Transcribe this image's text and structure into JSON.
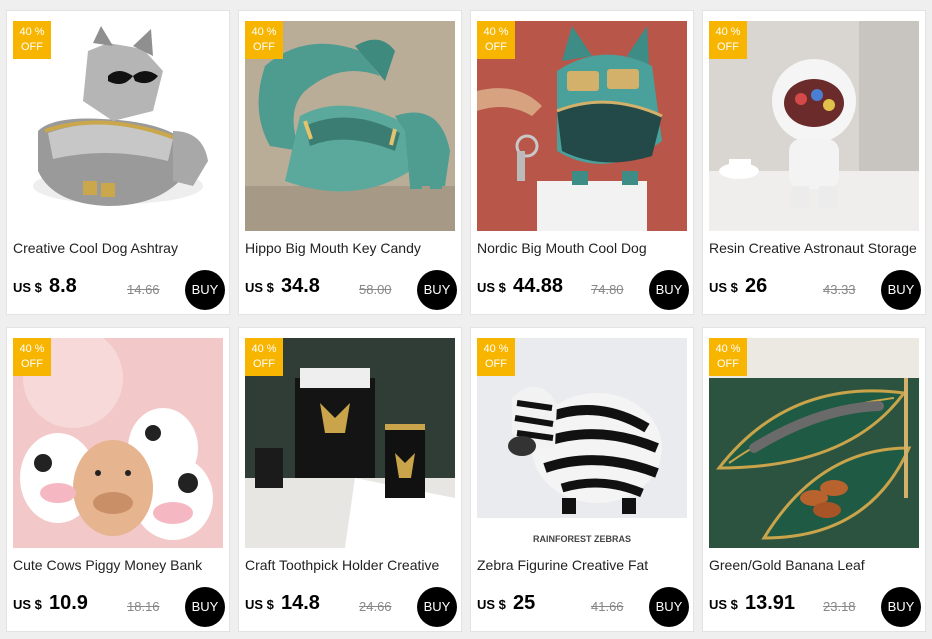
{
  "colors": {
    "badge": "#f7b500",
    "buy": "#000000",
    "page_bg": "#efefef",
    "card_bg": "#ffffff"
  },
  "products": [
    {
      "title": "Creative Cool Dog Ashtray",
      "discount_percent": "40 %",
      "discount_off": "OFF",
      "currency": "US $",
      "price": "8.8",
      "original_price": "14.66",
      "buy_label": "BUY",
      "image": "grey-dog-ashtray"
    },
    {
      "title": "Hippo Big Mouth Key Candy",
      "discount_percent": "40 %",
      "discount_off": "OFF",
      "currency": "US $",
      "price": "34.8",
      "original_price": "58.00",
      "buy_label": "BUY",
      "image": "teal-hippo-bowl"
    },
    {
      "title": "Nordic Big Mouth Cool Dog",
      "discount_percent": "40 %",
      "discount_off": "OFF",
      "currency": "US $",
      "price": "44.88",
      "original_price": "74.80",
      "buy_label": "BUY",
      "image": "teal-dog-key-holder"
    },
    {
      "title": "Resin Creative Astronaut Storage",
      "discount_percent": "40 %",
      "discount_off": "OFF",
      "currency": "US $",
      "price": "26",
      "original_price": "43.33",
      "buy_label": "BUY",
      "image": "astronaut-candy-storage"
    },
    {
      "title": "Cute Cows Piggy Money Bank",
      "discount_percent": "40 %",
      "discount_off": "OFF",
      "currency": "US $",
      "price": "10.9",
      "original_price": "18.16",
      "buy_label": "BUY",
      "image": "cow-piggy-banks"
    },
    {
      "title": "Craft Toothpick Holder Creative",
      "discount_percent": "40 %",
      "discount_off": "OFF",
      "currency": "US $",
      "price": "14.8",
      "original_price": "24.66",
      "buy_label": "BUY",
      "image": "black-gold-toothpick-holder"
    },
    {
      "title": "Zebra Figurine Creative Fat",
      "discount_percent": "40 %",
      "discount_off": "OFF",
      "currency": "US $",
      "price": "25",
      "original_price": "41.66",
      "buy_label": "BUY",
      "image": "fat-zebra-figurine",
      "image_caption": "RAINFOREST ZEBRAS"
    },
    {
      "title": "Green/Gold Banana Leaf",
      "discount_percent": "40 %",
      "discount_off": "OFF",
      "currency": "US $",
      "price": "13.91",
      "original_price": "23.18",
      "buy_label": "BUY",
      "image": "banana-leaf-plate"
    }
  ]
}
